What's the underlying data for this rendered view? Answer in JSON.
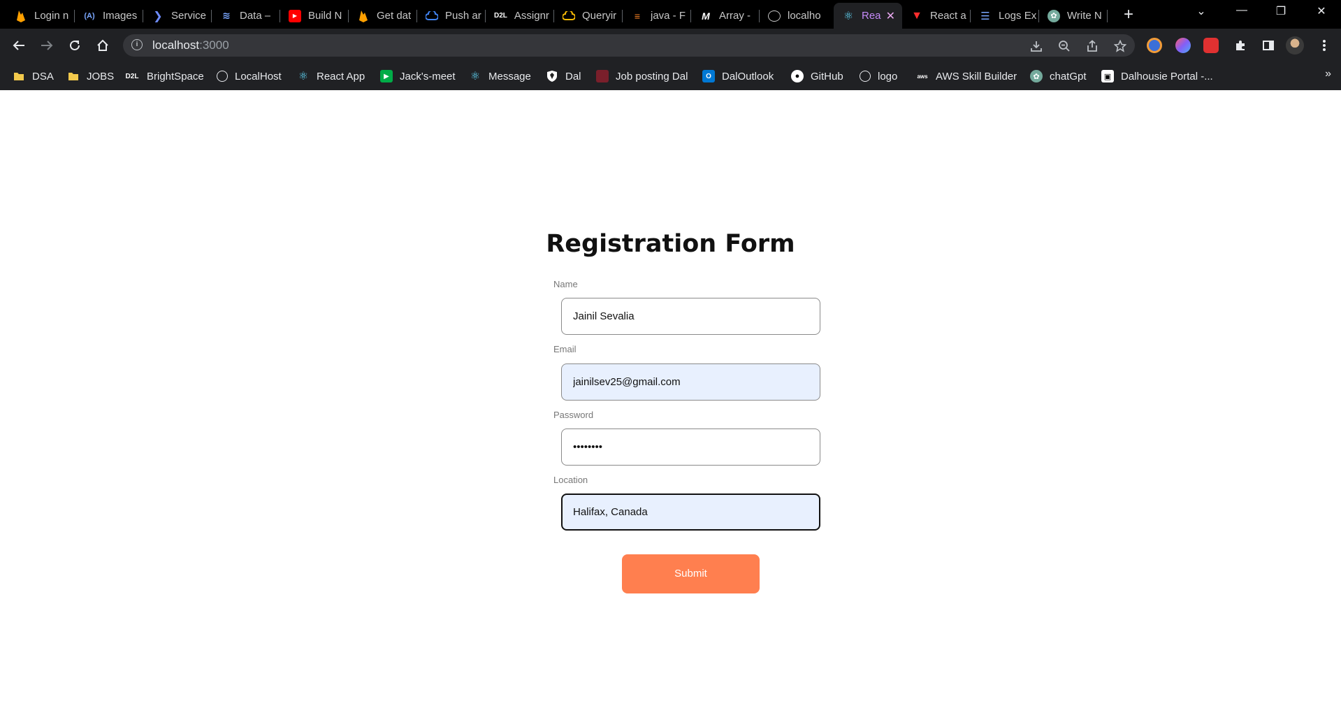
{
  "tabs": [
    {
      "label": "Login n",
      "icon": "firebase-icon"
    },
    {
      "label": "Images",
      "icon": "code-brackets-icon"
    },
    {
      "label": "Service",
      "icon": "chevron-service-icon"
    },
    {
      "label": "Data –",
      "icon": "layers-icon"
    },
    {
      "label": "Build N",
      "icon": "youtube-icon"
    },
    {
      "label": "Get dat",
      "icon": "firebase-icon"
    },
    {
      "label": "Push ar",
      "icon": "google-cloud-icon"
    },
    {
      "label": "Assignr",
      "icon": "d2l-icon"
    },
    {
      "label": "Queryir",
      "icon": "google-cloud-icon"
    },
    {
      "label": "java - F",
      "icon": "stackoverflow-icon"
    },
    {
      "label": "Array -",
      "icon": "medium-icon"
    },
    {
      "label": "localho",
      "icon": "globe-icon"
    },
    {
      "label": "Rea",
      "icon": "react-icon",
      "active": true
    },
    {
      "label": "React a",
      "icon": "vite-icon"
    },
    {
      "label": "Logs Ex",
      "icon": "list-icon"
    },
    {
      "label": "Write N",
      "icon": "chatgpt-icon"
    }
  ],
  "address": {
    "host": "localhost",
    "port": ":3000"
  },
  "bookmarks": [
    {
      "label": "DSA",
      "icon": "folder-icon"
    },
    {
      "label": "JOBS",
      "icon": "folder-icon"
    },
    {
      "label": "BrightSpace",
      "icon": "d2l-icon"
    },
    {
      "label": "LocalHost",
      "icon": "globe-icon"
    },
    {
      "label": "React App",
      "icon": "react-icon"
    },
    {
      "label": "Jack's-meet",
      "icon": "meet-icon"
    },
    {
      "label": "Message",
      "icon": "react-icon"
    },
    {
      "label": "Dal",
      "icon": "shield-icon"
    },
    {
      "label": "Job posting Dal",
      "icon": "briefcase-icon"
    },
    {
      "label": "DalOutlook",
      "icon": "outlook-icon"
    },
    {
      "label": "GitHub",
      "icon": "github-icon"
    },
    {
      "label": "logo",
      "icon": "globe-icon"
    },
    {
      "label": "AWS Skill Builder",
      "icon": "aws-icon"
    },
    {
      "label": "chatGpt",
      "icon": "chatgpt-icon"
    },
    {
      "label": "Dalhousie Portal -...",
      "icon": "portal-icon"
    }
  ],
  "form": {
    "title": "Registration Form",
    "name_label": "Name",
    "name_value": "Jainil Sevalia",
    "email_label": "Email",
    "email_value": "jainilsev25@gmail.com",
    "password_label": "Password",
    "password_value": "••••••••",
    "location_label": "Location",
    "location_value": "Halifax, Canada",
    "submit_label": "Submit"
  },
  "colors": {
    "submit_button": "#ff7f4f",
    "autofill_background": "#e8f0fe",
    "chrome_background": "#202124"
  }
}
